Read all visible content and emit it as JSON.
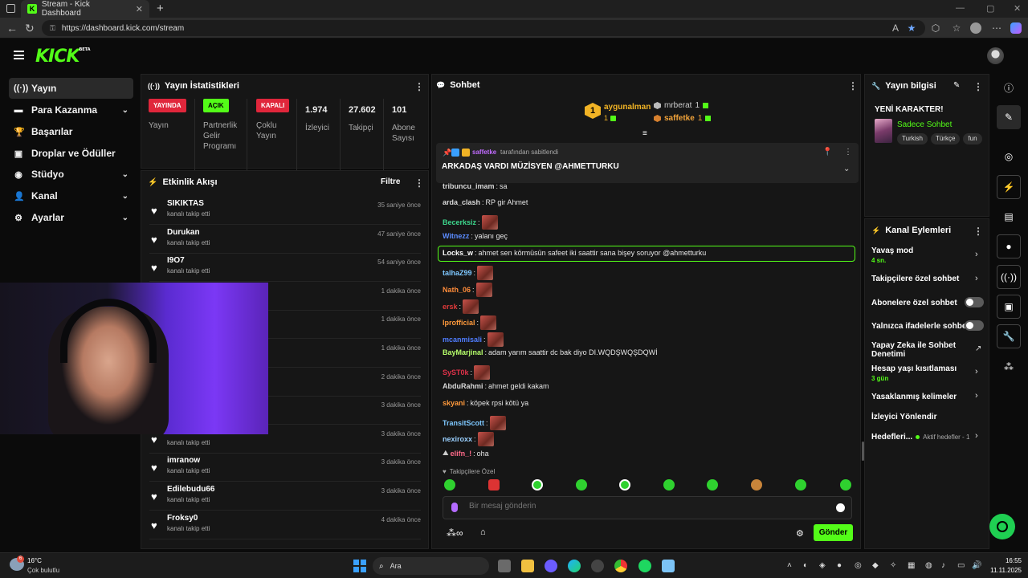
{
  "browser": {
    "tab_title": "Stream - Kick Dashboard",
    "url": "https://dashboard.kick.com/stream",
    "new_tab": "+"
  },
  "logo": {
    "text": "KICK",
    "badge": "BETA"
  },
  "sidebar": {
    "items": [
      {
        "label": "Yayın",
        "icon": "broadcast-icon"
      },
      {
        "label": "Para Kazanma",
        "icon": "money-icon"
      },
      {
        "label": "Başarılar",
        "icon": "trophy-icon"
      },
      {
        "label": "Droplar ve Ödüller",
        "icon": "gift-icon"
      },
      {
        "label": "Stüdyo",
        "icon": "studio-icon"
      },
      {
        "label": "Kanal",
        "icon": "user-icon"
      },
      {
        "label": "Ayarlar",
        "icon": "gear-icon"
      }
    ]
  },
  "stats": {
    "title": "Yayın İstatistikleri",
    "live_badge": "YAYINDA",
    "live_label": "Yayın",
    "partner_badge": "AÇIK",
    "partner_label_1": "Partnerlik",
    "partner_label_2": "Gelir",
    "partner_label_3": "Programı",
    "multi_badge": "KAPALI",
    "multi_label_1": "Çoklu",
    "multi_label_2": "Yayın",
    "viewers": "1.974",
    "viewers_label": "İzleyici",
    "followers": "27.602",
    "followers_label": "Takipçi",
    "subs": "101",
    "subs_label_1": "Abone",
    "subs_label_2": "Sayısı"
  },
  "activity": {
    "title": "Etkinlik Akışı",
    "filter": "Filtre",
    "items": [
      {
        "name": "SIKIKTAS",
        "sub": "kanalı takip etti",
        "time": "35 saniye önce"
      },
      {
        "name": "Durukan",
        "sub": "kanalı takip etti",
        "time": "47 saniye önce"
      },
      {
        "name": "I9O7",
        "sub": "kanalı takip etti",
        "time": "54 saniye önce"
      },
      {
        "name": "",
        "sub": "",
        "time": "1 dakika önce"
      },
      {
        "name": "",
        "sub": "",
        "time": "1 dakika önce"
      },
      {
        "name": "",
        "sub": "",
        "time": "1 dakika önce"
      },
      {
        "name": "",
        "sub": "",
        "time": "2 dakika önce"
      },
      {
        "name": "",
        "sub": "",
        "time": "3 dakika önce"
      },
      {
        "name": "Aberk",
        "sub": "kanalı takip etti",
        "time": "3 dakika önce"
      },
      {
        "name": "imranow",
        "sub": "kanalı takip etti",
        "time": "3 dakika önce"
      },
      {
        "name": "Edilebudu66",
        "sub": "kanalı takip etti",
        "time": "3 dakika önce"
      },
      {
        "name": "Froksy0",
        "sub": "kanalı takip etti",
        "time": "4 dakika önce"
      }
    ]
  },
  "chat": {
    "title": "Sohbet",
    "top1_name": "aygunalman",
    "top1_count": "1",
    "top1_rank": "1",
    "top2_name": "mrberat",
    "top2_count": "1",
    "top3_name": "saffetke",
    "top3_count": "1",
    "pinned_by_name": "saffetke",
    "pinned_by_text": "tarafından sabitlendi",
    "pinned_text": "ARKADAŞ VARDI MÜZİSYEN @AHMETTURKU",
    "messages": [
      {
        "user": "tribuncu_imam",
        "color": "#d9d9d9",
        "text": "sa",
        "emote": false
      },
      {
        "user": "arda_clash",
        "color": "#d9d9d9",
        "text": "RP gir Ahmet",
        "emote": false
      },
      {
        "user": "Becerksiz",
        "color": "#3dd68c",
        "text": "",
        "emote": true
      },
      {
        "user": "Witnezz",
        "color": "#5b8cff",
        "text": "yalanı geç",
        "emote": false
      },
      {
        "user": "Locks_w",
        "color": "#ffffff",
        "text": "ahmet sen körmüsün safeet iki saattir sana bişey soruyor @ahmetturku",
        "emote": false
      },
      {
        "user": "talhaZ99",
        "color": "#7ec8ff",
        "text": "",
        "emote": true
      },
      {
        "user": "Nath_06",
        "color": "#ff8c3a",
        "text": "",
        "emote": true
      },
      {
        "user": "ersk",
        "color": "#e03a3a",
        "text": "",
        "emote": true
      },
      {
        "user": "lprofficial",
        "color": "#ff9a3c",
        "text": "",
        "emote": true
      },
      {
        "user": "mcanmisali",
        "color": "#4f7dff",
        "text": "",
        "emote": true
      },
      {
        "user": "BayMarjinal",
        "color": "#b6ff6b",
        "text": "adam yarım saattir dc bak diyo DI.WQDŞWQŞDQWİ",
        "emote": false
      },
      {
        "user": "SyST0k",
        "color": "#e0324a",
        "text": "",
        "emote": true
      },
      {
        "user": "AbduRahmi",
        "color": "#d9d9d9",
        "text": "ahmet geldi kakam",
        "emote": false
      },
      {
        "user": "skyani",
        "color": "#ff9a3c",
        "text": "köpek rpsi kötü ya",
        "emote": false
      },
      {
        "user": "TransitScott",
        "color": "#7ec8ff",
        "text": "",
        "emote": true
      },
      {
        "user": "nexiroxx",
        "color": "#9ad0ff",
        "text": "",
        "emote": true
      },
      {
        "user": "elifn_!",
        "color": "#ff6b8a",
        "text": "oha",
        "emote": false
      }
    ],
    "followers_only": "Takipçilere Özel",
    "input_placeholder": "Bir mesaj gönderin",
    "send": "Gönder"
  },
  "stream_info": {
    "title": "Yayın bilgisi",
    "stream_title": "YENİ KARAKTER!",
    "category": "Sadece Sohbet",
    "tags": [
      "Turkish",
      "Türkçe",
      "fun"
    ]
  },
  "channel_actions": {
    "title": "Kanal Eylemleri",
    "slow_mode": "Yavaş mod",
    "slow_mode_val": "4 sn.",
    "followers_chat": "Takipçilere özel sohbet",
    "subs_chat": "Abonelere özel sohbet",
    "emote_chat": "Yalnızca ifadelerle sohbet",
    "ai_chat_1": "Yapay Zeka ile Sohbet",
    "ai_chat_2": "Denetimi",
    "age_limit": "Hesap yaşı kısıtlaması",
    "age_val": "3 gün",
    "banned_words": "Yasaklanmış kelimeler",
    "redirect": "İzleyici Yönlendir",
    "goals": "Hedefleri...",
    "goals_status": "Aktif hedefler - 1"
  },
  "taskbar": {
    "weather_temp": "16°C",
    "weather_desc": "Çok bulutlu",
    "search": "Ara",
    "time": "16:55",
    "date": "11.11.2025"
  },
  "colors": {
    "accent": "#53fc18",
    "live": "#e0263b",
    "panel": "#161616"
  }
}
